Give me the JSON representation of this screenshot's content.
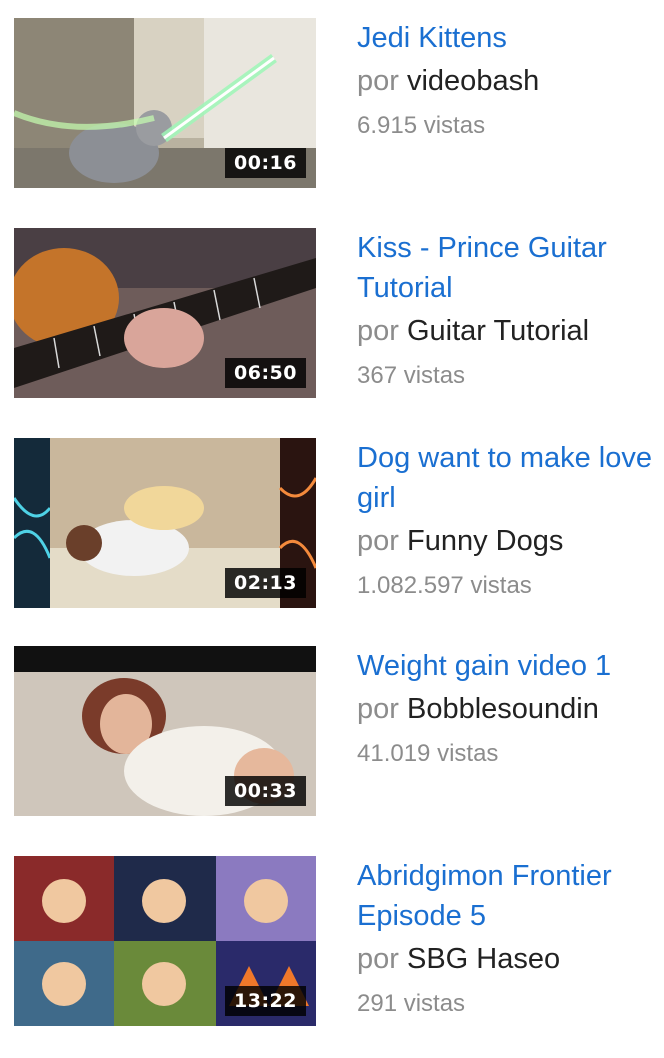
{
  "videos": [
    {
      "title": "Jedi Kittens",
      "by_prefix": "por",
      "channel": "videobash",
      "views": "6.915 vistas",
      "duration": "00:16"
    },
    {
      "title": "Kiss - Prince Guitar Tutorial",
      "by_prefix": "por",
      "channel": "Guitar Tutorial",
      "views": "367 vistas",
      "duration": "06:50"
    },
    {
      "title": "Dog want to make love girl",
      "by_prefix": "por",
      "channel": "Funny Dogs",
      "views": "1.082.597 vistas",
      "duration": "02:13"
    },
    {
      "title": "Weight gain video 1",
      "by_prefix": "por",
      "channel": "Bobblesoundin",
      "views": "41.019 vistas",
      "duration": "00:33"
    },
    {
      "title": "Abridgimon Frontier Episode 5",
      "by_prefix": "por",
      "channel": "SBG Haseo",
      "views": "291 vistas",
      "duration": "13:22"
    }
  ],
  "colors": {
    "link": "#1a6fd1",
    "meta": "#8c8c8c",
    "text": "#222222"
  }
}
